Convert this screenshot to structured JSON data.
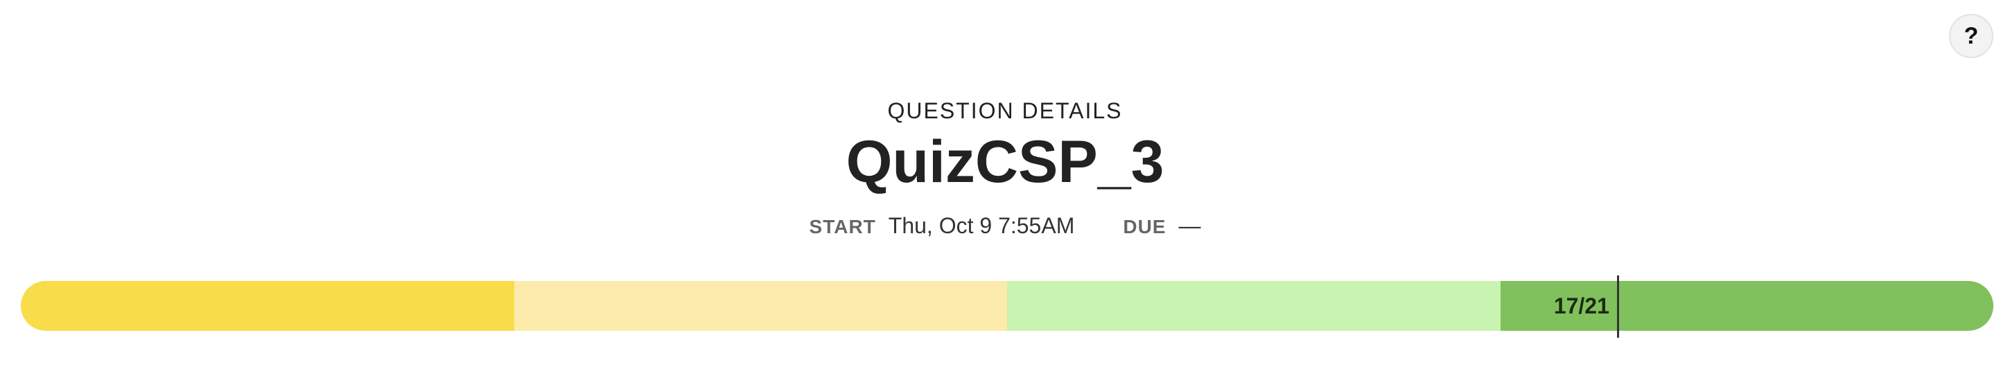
{
  "help": {
    "label": "?"
  },
  "header": {
    "eyebrow": "QUESTION DETAILS",
    "title": "QuizCSP_3"
  },
  "meta": {
    "start_label": "START",
    "start_value": "Thu, Oct 9 7:55AM",
    "due_label": "DUE",
    "due_value": "—"
  },
  "progress": {
    "score_text": "17/21",
    "score": 17,
    "total": 21,
    "segment_colors": [
      "#f8dc4a",
      "#fcebaa",
      "#c9f3b1",
      "#80c15d"
    ]
  }
}
